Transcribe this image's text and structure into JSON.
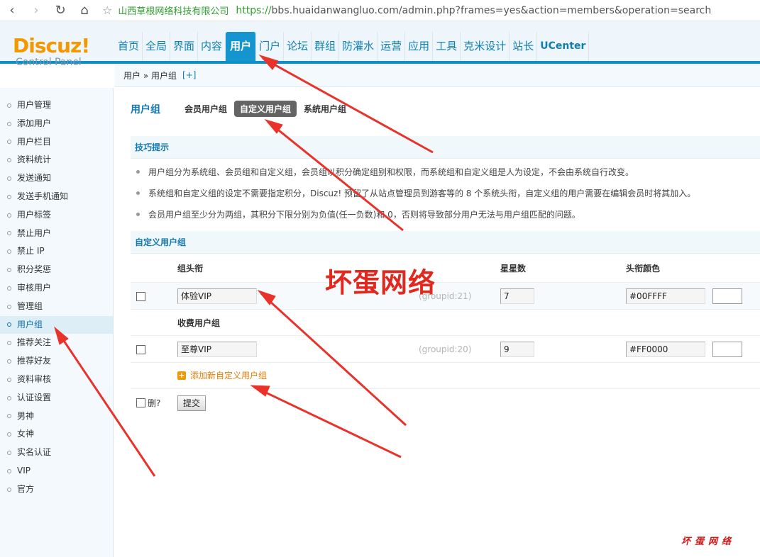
{
  "browser": {
    "back_icon": "‹",
    "forward_icon": "›",
    "reload_icon": "↻",
    "home_icon": "⌂",
    "star_icon": "☆",
    "site_name": "山西草根网络科技有限公司",
    "url_scheme": "https://",
    "url_rest": "bbs.huaidanwangluo.com/admin.php?frames=yes&action=members&operation=search"
  },
  "logo": {
    "main": "Discuz!",
    "sub": "Control Panel"
  },
  "topnav": [
    {
      "label": "首页"
    },
    {
      "label": "全局"
    },
    {
      "label": "界面"
    },
    {
      "label": "内容"
    },
    {
      "label": "用户",
      "active": true
    },
    {
      "label": "门户"
    },
    {
      "label": "论坛"
    },
    {
      "label": "群组"
    },
    {
      "label": "防灌水"
    },
    {
      "label": "运营"
    },
    {
      "label": "应用"
    },
    {
      "label": "工具"
    },
    {
      "label": "克米设计"
    },
    {
      "label": "站长"
    },
    {
      "label": "UCenter"
    }
  ],
  "breadcrumb": {
    "text": "用户 » 用户组",
    "add": "[+]"
  },
  "sidebar": [
    {
      "label": "用户管理"
    },
    {
      "label": "添加用户"
    },
    {
      "label": "用户栏目"
    },
    {
      "label": "资料统计"
    },
    {
      "label": "发送通知"
    },
    {
      "label": "发送手机通知"
    },
    {
      "label": "用户标签"
    },
    {
      "label": "禁止用户"
    },
    {
      "label": "禁止 IP"
    },
    {
      "label": "积分奖惩"
    },
    {
      "label": "审核用户"
    },
    {
      "label": "管理组"
    },
    {
      "label": "用户组",
      "active": true
    },
    {
      "label": "推荐关注"
    },
    {
      "label": "推荐好友"
    },
    {
      "label": "资料审核"
    },
    {
      "label": "认证设置"
    },
    {
      "label": "男神"
    },
    {
      "label": "女神"
    },
    {
      "label": "实名认证"
    },
    {
      "label": "VIP"
    },
    {
      "label": "官方"
    }
  ],
  "tabs": {
    "title": "用户组",
    "items": [
      "会员用户组",
      "自定义用户组",
      "系统用户组"
    ],
    "active_index": 1
  },
  "tips": {
    "heading": "技巧提示",
    "items": [
      "用户组分为系统组、会员组和自定义组，会员组以积分确定组别和权限，而系统组和自定义组是人为设定，不会由系统自行改变。",
      "系统组和自定义组的设定不需要指定积分，Discuz! 预留了从站点管理员到游客等的 8 个系统头衔，自定义组的用户需要在编辑会员时将其加入。",
      "会员用户组至少分为两组，其积分下限分别为负值(任一负数)和 0，否则将导致部分用户无法与用户组匹配的问题。"
    ]
  },
  "custom_groups": {
    "heading": "自定义用户组",
    "columns": {
      "title": "组头衔",
      "stars": "星星数",
      "color": "头衔颜色"
    },
    "rows": [
      {
        "name": "体验VIP",
        "groupid": "(groupid:21)",
        "stars": "7",
        "color": "#00FFFF",
        "sub_label": "收费用户组"
      },
      {
        "name": "至尊VIP",
        "groupid": "(groupid:20)",
        "stars": "9",
        "color": "#FF0000"
      }
    ],
    "add_label": "添加新自定义用户组",
    "delete_label": "删?",
    "submit_label": "提交"
  },
  "watermark": {
    "big": "坏蛋网络",
    "small": "坏蛋网络"
  },
  "colors": {
    "accent": "#1595cf",
    "arrow": "#e8322a",
    "logo": "#f39800"
  }
}
